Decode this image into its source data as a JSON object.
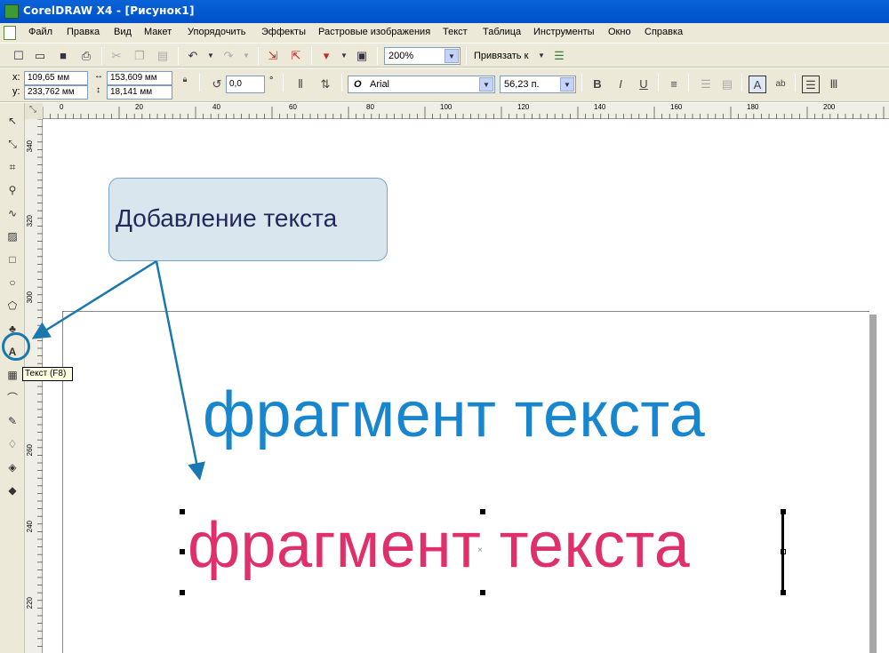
{
  "window": {
    "title": "CorelDRAW X4 - [Рисунок1]"
  },
  "menubar": {
    "items": [
      "Файл",
      "Правка",
      "Вид",
      "Макет",
      "Упорядочить",
      "Эффекты",
      "Растровые изображения",
      "Текст",
      "Таблица",
      "Инструменты",
      "Окно",
      "Справка"
    ]
  },
  "std_toolbar": {
    "zoom": "200%",
    "snap_label": "Привязать к"
  },
  "property_bar": {
    "x_label": "x:",
    "y_label": "y:",
    "x_value": "109,65 мм",
    "y_value": "233,762 мм",
    "width_value": "153,609 мм",
    "height_value": "18,141 мм",
    "rotation_value": "0,0",
    "rotation_unit": "°",
    "font_name": "Arial",
    "font_size": "56,23 п."
  },
  "ruler": {
    "top_labels": [
      "0",
      "20",
      "40",
      "60",
      "80",
      "100",
      "120",
      "140",
      "160",
      "180",
      "200"
    ],
    "left_labels": [
      "340",
      "320",
      "300",
      "260",
      "240",
      "220"
    ]
  },
  "tooltip": {
    "text": "Текст (F8)"
  },
  "callout": {
    "text": "Добавление текста"
  },
  "canvas": {
    "text_blue": "фрагмент текста",
    "text_pink": "фрагмент текста"
  },
  "colors": {
    "blue_text": "#1786cf",
    "pink_text": "#e0306c",
    "callout_fill": "#d9e6ee",
    "arrow": "#1a78b0"
  }
}
